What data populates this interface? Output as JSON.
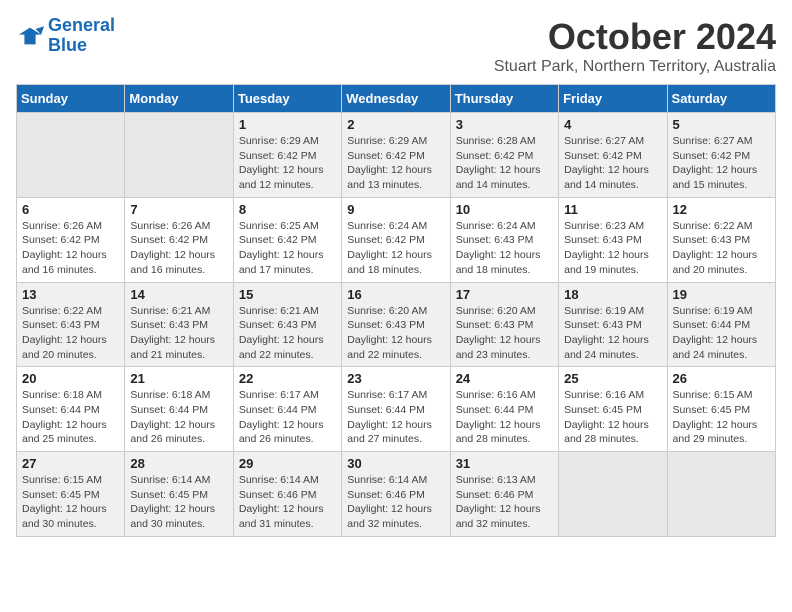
{
  "logo": {
    "line1": "General",
    "line2": "Blue"
  },
  "title": "October 2024",
  "subtitle": "Stuart Park, Northern Territory, Australia",
  "weekdays": [
    "Sunday",
    "Monday",
    "Tuesday",
    "Wednesday",
    "Thursday",
    "Friday",
    "Saturday"
  ],
  "weeks": [
    [
      {
        "day": "",
        "info": ""
      },
      {
        "day": "",
        "info": ""
      },
      {
        "day": "1",
        "sunrise": "6:29 AM",
        "sunset": "6:42 PM",
        "daylight": "12 hours and 12 minutes."
      },
      {
        "day": "2",
        "sunrise": "6:29 AM",
        "sunset": "6:42 PM",
        "daylight": "12 hours and 13 minutes."
      },
      {
        "day": "3",
        "sunrise": "6:28 AM",
        "sunset": "6:42 PM",
        "daylight": "12 hours and 14 minutes."
      },
      {
        "day": "4",
        "sunrise": "6:27 AM",
        "sunset": "6:42 PM",
        "daylight": "12 hours and 14 minutes."
      },
      {
        "day": "5",
        "sunrise": "6:27 AM",
        "sunset": "6:42 PM",
        "daylight": "12 hours and 15 minutes."
      }
    ],
    [
      {
        "day": "6",
        "sunrise": "6:26 AM",
        "sunset": "6:42 PM",
        "daylight": "12 hours and 16 minutes."
      },
      {
        "day": "7",
        "sunrise": "6:26 AM",
        "sunset": "6:42 PM",
        "daylight": "12 hours and 16 minutes."
      },
      {
        "day": "8",
        "sunrise": "6:25 AM",
        "sunset": "6:42 PM",
        "daylight": "12 hours and 17 minutes."
      },
      {
        "day": "9",
        "sunrise": "6:24 AM",
        "sunset": "6:42 PM",
        "daylight": "12 hours and 18 minutes."
      },
      {
        "day": "10",
        "sunrise": "6:24 AM",
        "sunset": "6:43 PM",
        "daylight": "12 hours and 18 minutes."
      },
      {
        "day": "11",
        "sunrise": "6:23 AM",
        "sunset": "6:43 PM",
        "daylight": "12 hours and 19 minutes."
      },
      {
        "day": "12",
        "sunrise": "6:22 AM",
        "sunset": "6:43 PM",
        "daylight": "12 hours and 20 minutes."
      }
    ],
    [
      {
        "day": "13",
        "sunrise": "6:22 AM",
        "sunset": "6:43 PM",
        "daylight": "12 hours and 20 minutes."
      },
      {
        "day": "14",
        "sunrise": "6:21 AM",
        "sunset": "6:43 PM",
        "daylight": "12 hours and 21 minutes."
      },
      {
        "day": "15",
        "sunrise": "6:21 AM",
        "sunset": "6:43 PM",
        "daylight": "12 hours and 22 minutes."
      },
      {
        "day": "16",
        "sunrise": "6:20 AM",
        "sunset": "6:43 PM",
        "daylight": "12 hours and 22 minutes."
      },
      {
        "day": "17",
        "sunrise": "6:20 AM",
        "sunset": "6:43 PM",
        "daylight": "12 hours and 23 minutes."
      },
      {
        "day": "18",
        "sunrise": "6:19 AM",
        "sunset": "6:43 PM",
        "daylight": "12 hours and 24 minutes."
      },
      {
        "day": "19",
        "sunrise": "6:19 AM",
        "sunset": "6:44 PM",
        "daylight": "12 hours and 24 minutes."
      }
    ],
    [
      {
        "day": "20",
        "sunrise": "6:18 AM",
        "sunset": "6:44 PM",
        "daylight": "12 hours and 25 minutes."
      },
      {
        "day": "21",
        "sunrise": "6:18 AM",
        "sunset": "6:44 PM",
        "daylight": "12 hours and 26 minutes."
      },
      {
        "day": "22",
        "sunrise": "6:17 AM",
        "sunset": "6:44 PM",
        "daylight": "12 hours and 26 minutes."
      },
      {
        "day": "23",
        "sunrise": "6:17 AM",
        "sunset": "6:44 PM",
        "daylight": "12 hours and 27 minutes."
      },
      {
        "day": "24",
        "sunrise": "6:16 AM",
        "sunset": "6:44 PM",
        "daylight": "12 hours and 28 minutes."
      },
      {
        "day": "25",
        "sunrise": "6:16 AM",
        "sunset": "6:45 PM",
        "daylight": "12 hours and 28 minutes."
      },
      {
        "day": "26",
        "sunrise": "6:15 AM",
        "sunset": "6:45 PM",
        "daylight": "12 hours and 29 minutes."
      }
    ],
    [
      {
        "day": "27",
        "sunrise": "6:15 AM",
        "sunset": "6:45 PM",
        "daylight": "12 hours and 30 minutes."
      },
      {
        "day": "28",
        "sunrise": "6:14 AM",
        "sunset": "6:45 PM",
        "daylight": "12 hours and 30 minutes."
      },
      {
        "day": "29",
        "sunrise": "6:14 AM",
        "sunset": "6:46 PM",
        "daylight": "12 hours and 31 minutes."
      },
      {
        "day": "30",
        "sunrise": "6:14 AM",
        "sunset": "6:46 PM",
        "daylight": "12 hours and 32 minutes."
      },
      {
        "day": "31",
        "sunrise": "6:13 AM",
        "sunset": "6:46 PM",
        "daylight": "12 hours and 32 minutes."
      },
      {
        "day": "",
        "info": ""
      },
      {
        "day": "",
        "info": ""
      }
    ]
  ],
  "labels": {
    "sunrise": "Sunrise: ",
    "sunset": "Sunset: ",
    "daylight": "Daylight: "
  }
}
